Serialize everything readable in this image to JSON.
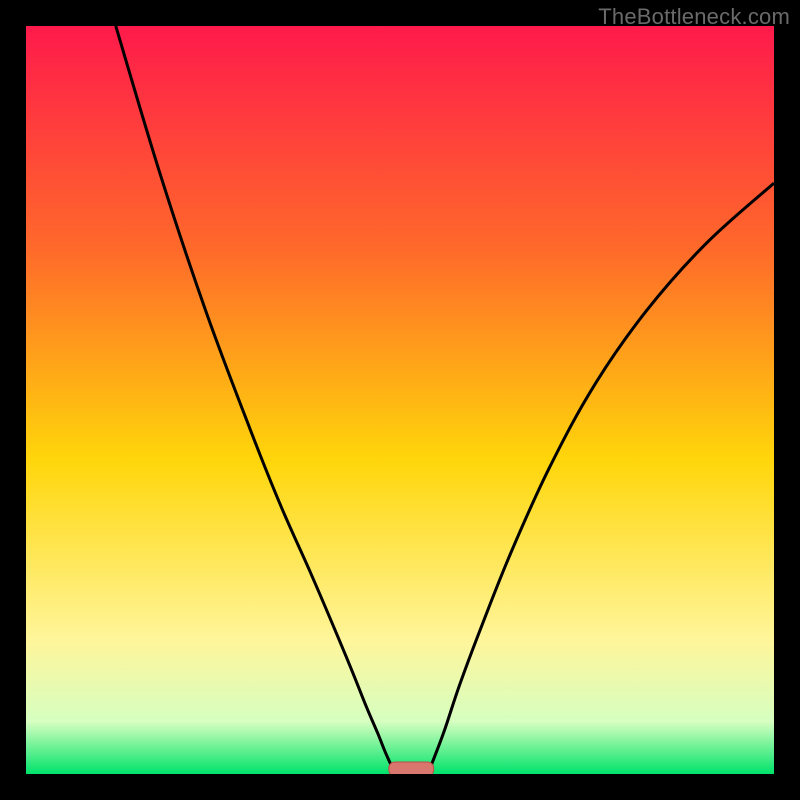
{
  "watermark": "TheBottleneck.com",
  "colors": {
    "bg": "#000000",
    "grad_top": "#ff1a4b",
    "grad_mid1": "#ff6a2a",
    "grad_mid2": "#ffd60a",
    "grad_low1": "#fff59a",
    "grad_low2": "#d6ffc0",
    "grad_bottom": "#00e36a",
    "curve": "#000000",
    "marker_fill": "#d9766e",
    "marker_stroke": "#b94f4a"
  },
  "chart_data": {
    "type": "line",
    "title": "",
    "xlabel": "",
    "ylabel": "",
    "xlim": [
      0,
      100
    ],
    "ylim": [
      0,
      100
    ],
    "series": [
      {
        "name": "left-branch",
        "x": [
          12,
          18,
          24,
          30,
          34,
          38,
          41,
          43.5,
          45.5,
          47,
          48,
          48.8,
          49.3
        ],
        "y": [
          100,
          80,
          62,
          46,
          36,
          27,
          20,
          14,
          9,
          5.5,
          3,
          1.2,
          0
        ]
      },
      {
        "name": "right-branch",
        "x": [
          53.7,
          54.5,
          56,
          58,
          61,
          65,
          70,
          76,
          83,
          91,
          100
        ],
        "y": [
          0,
          2,
          6,
          12,
          20,
          30,
          41,
          52,
          62,
          71,
          79
        ]
      }
    ],
    "marker": {
      "name": "bottleneck-zone",
      "x_center": 51.5,
      "width": 6,
      "y": 0,
      "height": 2
    },
    "gradient_stops": [
      {
        "offset": 0.0,
        "color": "#ff1a4b"
      },
      {
        "offset": 0.3,
        "color": "#ff6a2a"
      },
      {
        "offset": 0.58,
        "color": "#ffd60a"
      },
      {
        "offset": 0.82,
        "color": "#fff59a"
      },
      {
        "offset": 0.93,
        "color": "#d6ffc0"
      },
      {
        "offset": 1.0,
        "color": "#00e36a"
      }
    ]
  }
}
